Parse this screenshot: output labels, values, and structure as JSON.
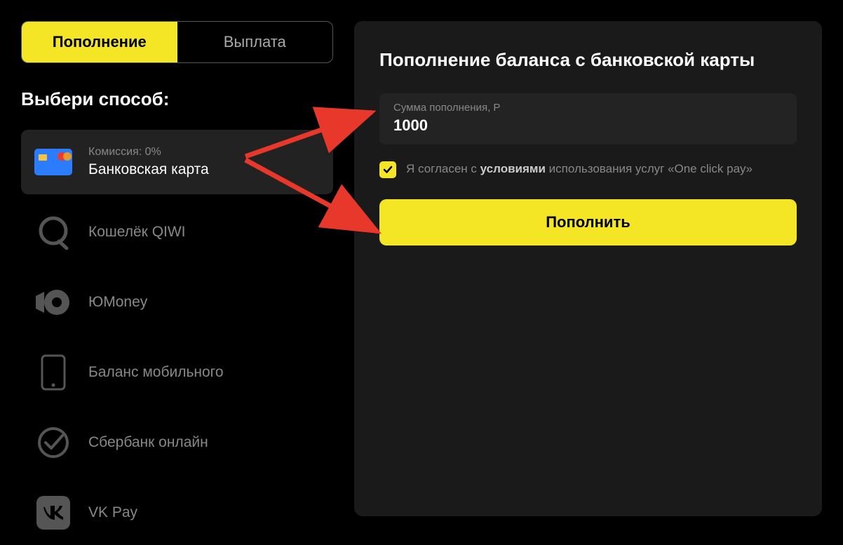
{
  "tabs": {
    "deposit": "Пополнение",
    "withdraw": "Выплата"
  },
  "section_title": "Выбери способ:",
  "methods": [
    {
      "commission": "Комиссия: 0%",
      "label": "Банковская карта"
    },
    {
      "label": "Кошелёк QIWI"
    },
    {
      "label": "ЮMoney"
    },
    {
      "label": "Баланс мобильного"
    },
    {
      "label": "Сбербанк онлайн"
    },
    {
      "label": "VK Pay"
    }
  ],
  "form": {
    "title": "Пополнение баланса с банковской карты",
    "amount_label": "Сумма пополнения, Р",
    "amount_value": "1000",
    "consent_prefix": "Я согласен с ",
    "consent_bold": "условиями",
    "consent_suffix": " использования услуг «One click pay»",
    "submit": "Пополнить"
  }
}
